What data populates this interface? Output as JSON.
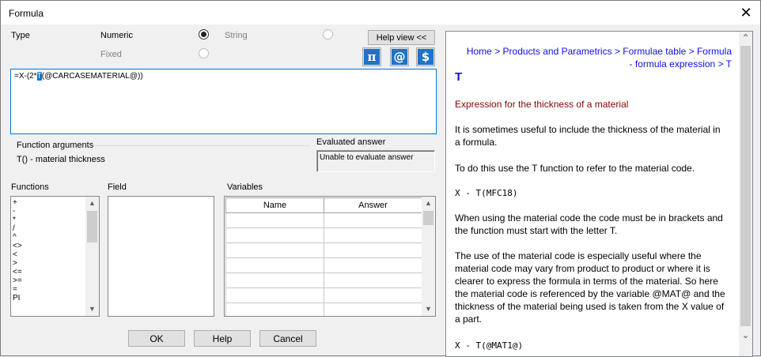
{
  "window": {
    "title": "Formula",
    "close_glyph": "✕"
  },
  "type_section": {
    "label": "Type",
    "numeric_label": "Numeric",
    "string_label": "String",
    "fixed_label": "Fixed",
    "help_view_label": "Help view <<"
  },
  "icons": [
    "pi-icon",
    "at-icon",
    "dollar-icon"
  ],
  "icon_glyphs": {
    "pi": "π",
    "at": "@",
    "dollar": "$"
  },
  "formula": {
    "before": "=X-(2*",
    "selected": "T",
    "after": "(@CARCASEMATERIAL@))"
  },
  "function_arguments": {
    "label": "Function arguments",
    "text": "T() - material thickness"
  },
  "evaluated": {
    "label": "Evaluated answer",
    "text": "Unable to evaluate answer"
  },
  "functions": {
    "label": "Functions",
    "items": [
      "+",
      "-",
      "*",
      "/",
      "^",
      "<>",
      "<",
      ">",
      "<=",
      ">=",
      "=",
      "PI"
    ]
  },
  "field": {
    "label": "Field"
  },
  "variables": {
    "label": "Variables",
    "col_name": "Name",
    "col_answer": "Answer"
  },
  "buttons": {
    "ok": "OK",
    "help": "Help",
    "cancel": "Cancel"
  },
  "help": {
    "breadcrumb": "Home > Products and Parametrics > Formulae table > Formula - formula expression > T",
    "title": "T",
    "subtitle": "Expression for the thickness of a material",
    "p1": "It is sometimes useful to include the thickness of the material in a formula.",
    "p2": "To do this use the T function to refer to the material code.",
    "code1": "X - T(MFC18)",
    "p3": "When using the material code the code must be in brackets and the function must start with the letter T.",
    "p4": "The use of the material code is especially useful where the material code may vary from product to product or where it is clearer to express the formula in terms of the material. So here the material code is referenced by the variable @MAT@ and the thickness of the material being used is taken from the X value of a part.",
    "code2": "X - T(@MAT1@)"
  },
  "scroll_glyphs": {
    "up": "▲",
    "down": "▼",
    "help_up": "⌃",
    "help_down": "⌄"
  }
}
